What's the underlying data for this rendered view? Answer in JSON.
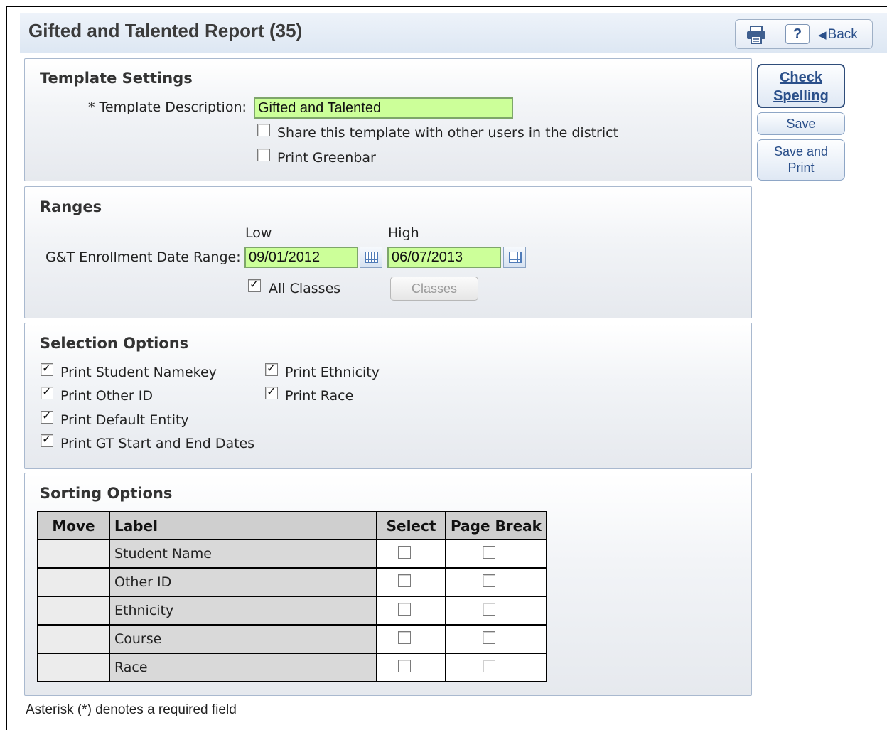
{
  "header": {
    "title": "Gifted and Talented Report (35)",
    "help_label": "?",
    "back_label": "Back"
  },
  "side_buttons": {
    "check_spelling_line1": "Check",
    "check_spelling_line2": "Spelling",
    "save": "Save",
    "save_and_print_line1": "Save and",
    "save_and_print_line2": "Print"
  },
  "template_settings": {
    "title": "Template Settings",
    "description_label": "* Template Description:",
    "description_value": "Gifted and Talented",
    "share_label": "Share this template with other users in the district",
    "share_checked": false,
    "greenbar_label": "Print Greenbar",
    "greenbar_checked": false
  },
  "ranges": {
    "title": "Ranges",
    "low_label": "Low",
    "high_label": "High",
    "date_range_label": "G&T Enrollment Date Range:",
    "low_value": "09/01/2012",
    "high_value": "06/07/2013",
    "all_classes_label": "All Classes",
    "all_classes_checked": true,
    "classes_button": "Classes"
  },
  "selection_options": {
    "title": "Selection Options",
    "items": [
      {
        "label": "Print Student Namekey",
        "checked": true
      },
      {
        "label": "Print Other ID",
        "checked": true
      },
      {
        "label": "Print Default Entity",
        "checked": true
      },
      {
        "label": "Print GT Start and End Dates",
        "checked": true
      },
      {
        "label": "Print Ethnicity",
        "checked": true
      },
      {
        "label": "Print Race",
        "checked": true
      }
    ]
  },
  "sorting_options": {
    "title": "Sorting Options",
    "columns": [
      "Move",
      "Label",
      "Select",
      "Page Break"
    ],
    "rows": [
      {
        "label": "Student Name",
        "select": false,
        "page_break": false
      },
      {
        "label": "Other ID",
        "select": false,
        "page_break": false
      },
      {
        "label": "Ethnicity",
        "select": false,
        "page_break": false
      },
      {
        "label": "Course",
        "select": false,
        "page_break": false
      },
      {
        "label": "Race",
        "select": false,
        "page_break": false
      }
    ]
  },
  "footnote": "Asterisk (*) denotes a required field"
}
